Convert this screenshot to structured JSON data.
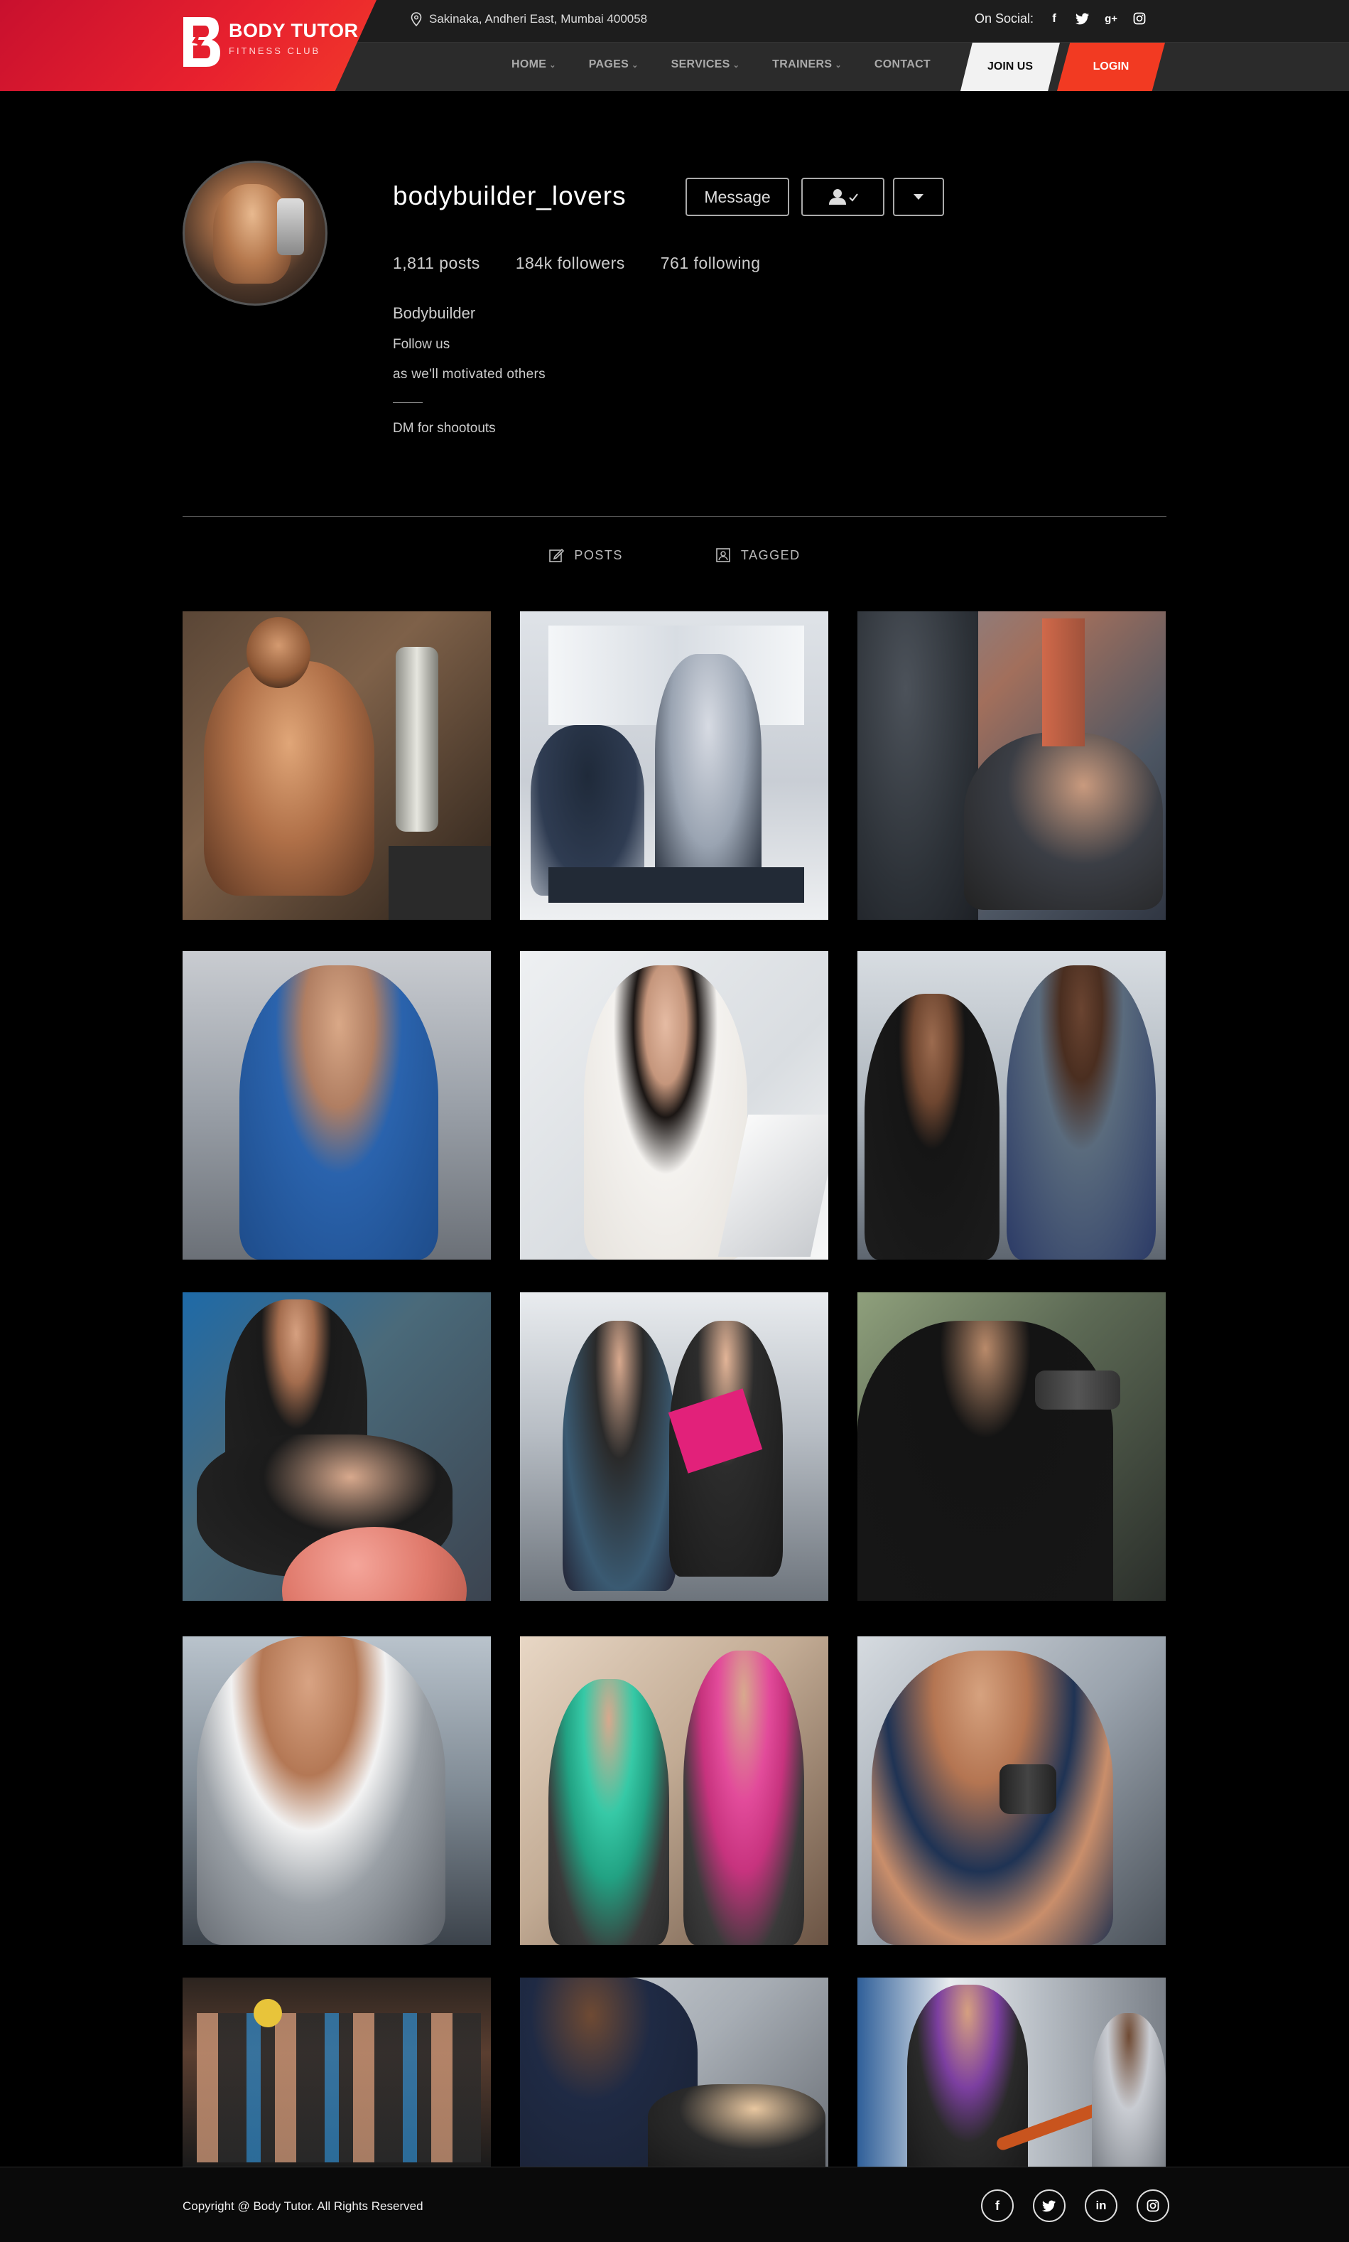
{
  "brand": {
    "title": "BODY TUTOR",
    "subtitle": "FITNESS CLUB"
  },
  "header": {
    "address": "Sakinaka, Andheri East, Mumbai 400058",
    "social_label": "On Social:",
    "social_icons": [
      "facebook-icon",
      "twitter-icon",
      "google-plus-icon",
      "instagram-icon"
    ],
    "nav": [
      {
        "label": "HOME",
        "dropdown": true
      },
      {
        "label": "PAGES",
        "dropdown": true
      },
      {
        "label": "SERVICES",
        "dropdown": true
      },
      {
        "label": "TRAINERS",
        "dropdown": true
      },
      {
        "label": "CONTACT",
        "dropdown": false
      }
    ],
    "join_label": "JOIN US",
    "login_label": "LOGIN",
    "accent_color": "#f23a22"
  },
  "profile": {
    "username": "bodybuilder_lovers",
    "message_label": "Message",
    "stats": {
      "posts": "1,811 posts",
      "followers": "184k followers",
      "following": "761 following"
    },
    "bio": {
      "line1": "Bodybuilder",
      "line2": "Follow us",
      "line3": "as we'll motivated others",
      "line4": "DM for shootouts"
    }
  },
  "tabs": {
    "posts": "POSTS",
    "tagged": "TAGGED"
  },
  "footer": {
    "copyright": "Copyright @ Body Tutor. All Rights Reserved",
    "social_icons": [
      "facebook-icon",
      "twitter-icon",
      "linkedin-icon",
      "instagram-icon"
    ]
  }
}
